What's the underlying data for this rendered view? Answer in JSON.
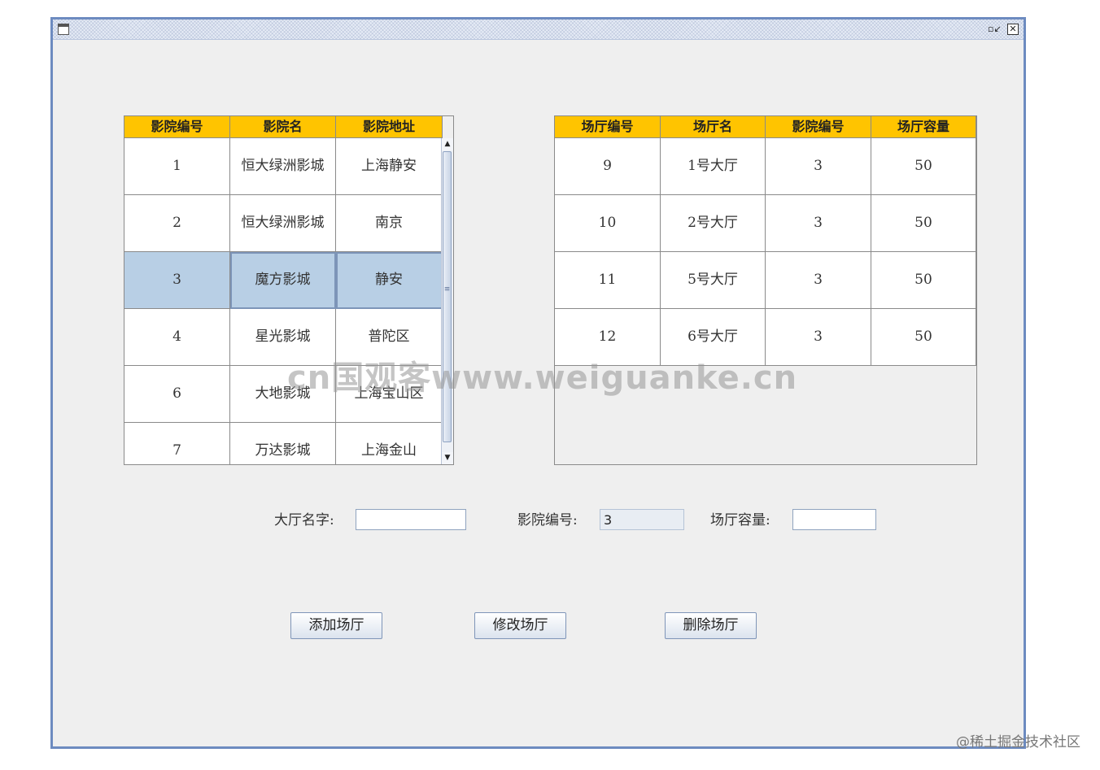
{
  "window": {
    "icons": {
      "app": "app-window-icon",
      "restore": "restore-icon",
      "close": "close-icon"
    }
  },
  "cinema_table": {
    "headers": [
      "影院编号",
      "影院名",
      "影院地址"
    ],
    "rows": [
      [
        "1",
        "恒大绿洲影城",
        "上海静安"
      ],
      [
        "2",
        "恒大绿洲影城",
        "南京"
      ],
      [
        "3",
        "魔方影城",
        "静安"
      ],
      [
        "4",
        "星光影城",
        "普陀区"
      ],
      [
        "6",
        "大地影城",
        "上海宝山区"
      ],
      [
        "7",
        "万达影城",
        "上海金山"
      ]
    ],
    "selected_row": 2
  },
  "hall_table": {
    "headers": [
      "场厅编号",
      "场厅名",
      "影院编号",
      "场厅容量"
    ],
    "rows": [
      [
        "9",
        "1号大厅",
        "3",
        "50"
      ],
      [
        "10",
        "2号大厅",
        "3",
        "50"
      ],
      [
        "11",
        "5号大厅",
        "3",
        "50"
      ],
      [
        "12",
        "6号大厅",
        "3",
        "50"
      ]
    ]
  },
  "form": {
    "hall_name_label": "大厅名字:",
    "hall_name_value": "",
    "cinema_id_label": "影院编号:",
    "cinema_id_value": "3",
    "capacity_label": "场厅容量:",
    "capacity_value": ""
  },
  "buttons": {
    "add": "添加场厅",
    "edit": "修改场厅",
    "delete": "删除场厅"
  },
  "watermark": "cn国观客www.weiguanke.cn",
  "credit": "@稀土掘金技术社区",
  "colors": {
    "header_bg": "#ffc400",
    "selected_row_bg": "#b8cfe5",
    "window_border": "#6d8bc0",
    "window_bg": "#efefef"
  }
}
